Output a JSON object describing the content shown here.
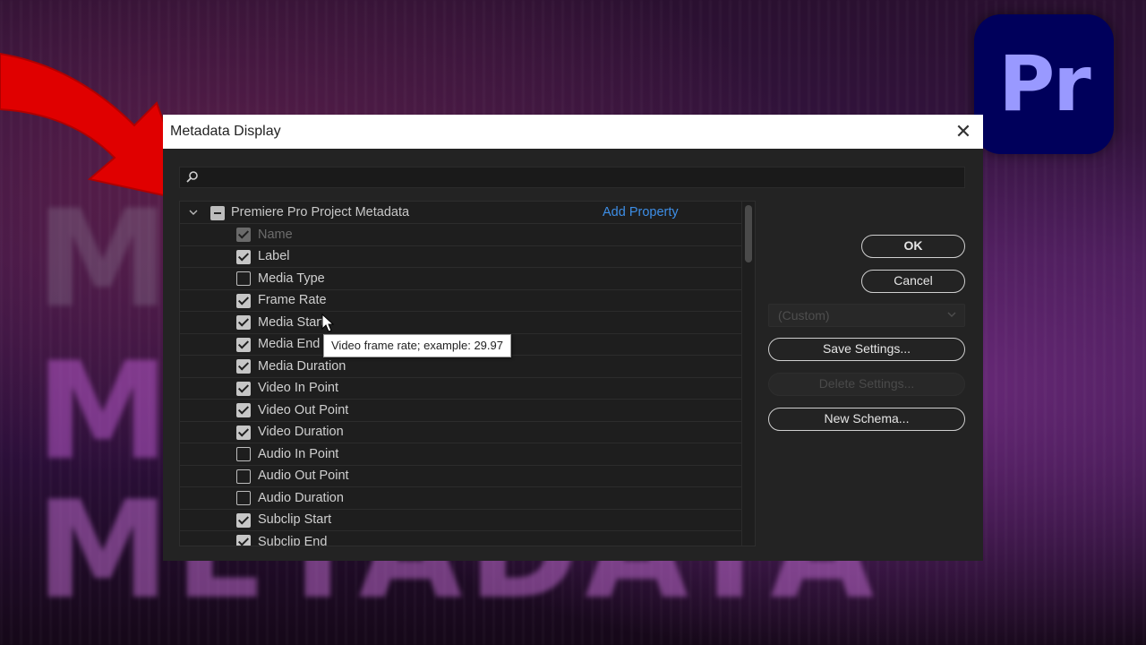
{
  "dialog": {
    "title": "Metadata Display",
    "search": {
      "value": "",
      "placeholder": ""
    },
    "group": {
      "label": "Premiere Pro Project Metadata",
      "add_property": "Add Property"
    },
    "items": [
      {
        "label": "Name",
        "checked": true,
        "disabled": true
      },
      {
        "label": "Label",
        "checked": true,
        "disabled": false
      },
      {
        "label": "Media Type",
        "checked": false,
        "disabled": false
      },
      {
        "label": "Frame Rate",
        "checked": true,
        "disabled": false
      },
      {
        "label": "Media Start",
        "checked": true,
        "disabled": false
      },
      {
        "label": "Media End",
        "checked": true,
        "disabled": false
      },
      {
        "label": "Media Duration",
        "checked": true,
        "disabled": false
      },
      {
        "label": "Video In Point",
        "checked": true,
        "disabled": false
      },
      {
        "label": "Video Out Point",
        "checked": true,
        "disabled": false
      },
      {
        "label": "Video Duration",
        "checked": true,
        "disabled": false
      },
      {
        "label": "Audio In Point",
        "checked": false,
        "disabled": false
      },
      {
        "label": "Audio Out Point",
        "checked": false,
        "disabled": false
      },
      {
        "label": "Audio Duration",
        "checked": false,
        "disabled": false
      },
      {
        "label": "Subclip Start",
        "checked": true,
        "disabled": false
      },
      {
        "label": "Subclip End",
        "checked": true,
        "disabled": false
      }
    ],
    "tooltip": "Video frame rate; example: 29.97",
    "buttons": {
      "ok": "OK",
      "cancel": "Cancel",
      "preset": "(Custom)",
      "save_settings": "Save Settings...",
      "delete_settings": "Delete Settings...",
      "new_schema": "New Schema..."
    }
  },
  "logo": {
    "text": "Pr"
  },
  "background": {
    "word": "METADATA"
  },
  "colors": {
    "accent": "#3d8ee6",
    "arrow": "#e00000",
    "logo_bg": "#00005b",
    "logo_text": "#9999ff"
  }
}
